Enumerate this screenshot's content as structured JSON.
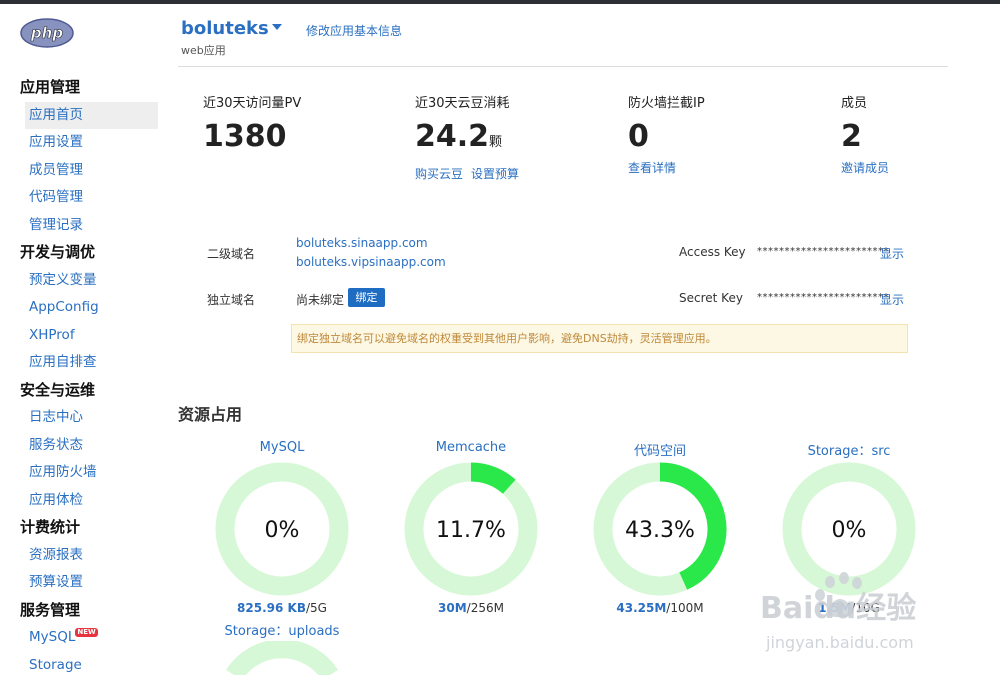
{
  "header": {
    "logo_text": "php",
    "app_name": "boluteks",
    "app_type": "web应用",
    "edit_link": "修改应用基本信息"
  },
  "sidebar": {
    "sections": [
      {
        "title": "应用管理",
        "items": [
          "应用首页",
          "应用设置",
          "成员管理",
          "代码管理",
          "管理记录"
        ]
      },
      {
        "title": "开发与调优",
        "items": [
          "预定义变量",
          "AppConfig",
          "XHProf",
          "应用自排查"
        ]
      },
      {
        "title": "安全与运维",
        "items": [
          "日志中心",
          "服务状态",
          "应用防火墙",
          "应用体检"
        ]
      },
      {
        "title": "计费统计",
        "items": [
          "资源报表",
          "预算设置"
        ]
      },
      {
        "title": "服务管理",
        "items": [
          "MySQL",
          "Storage"
        ]
      }
    ],
    "active_item": "应用首页",
    "new_badge": "NEW"
  },
  "stats": {
    "pv_label": "近30天访问量PV",
    "pv_value": "1380",
    "bean_label": "近30天云豆消耗",
    "bean_value": "24.2",
    "bean_unit": "颗",
    "buy_link": "购买云豆",
    "budget_link": "设置预算",
    "fw_label": "防火墙拦截IP",
    "fw_value": "0",
    "fw_link": "查看详情",
    "member_label": "成员",
    "member_value": "2",
    "invite_link": "邀请成员"
  },
  "domains": {
    "second_label": "二级域名",
    "second_1": "boluteks.sinaapp.com",
    "second_2": "boluteks.vipsinaapp.com",
    "custom_label": "独立域名",
    "unbound_text": "尚未绑定",
    "bind_button": "绑定",
    "access_key_label": "Access Key",
    "access_key_value": "************************",
    "secret_key_label": "Secret Key",
    "secret_key_value": "************************",
    "show_label": "显示",
    "notice": "绑定独立域名可以避免域名的权重受到其他用户影响，避免DNS劫持，灵活管理应用。"
  },
  "resources": {
    "title": "资源占用",
    "track_color": "#d6f8d6",
    "fill_color": "#2be84a",
    "gauges": [
      {
        "name": "MySQL",
        "percent_text": "0%",
        "fraction": 0.0,
        "used": "825.96 KB",
        "total": "/5G"
      },
      {
        "name": "Memcache",
        "percent_text": "11.7%",
        "fraction": 0.117,
        "used": "30M",
        "total": "/256M"
      },
      {
        "name": "代码空间",
        "percent_text": "43.3%",
        "fraction": 0.433,
        "used": "43.25M",
        "total": "/100M"
      },
      {
        "name": "Storage：src",
        "percent_text": "0%",
        "fraction": 0.0,
        "used": "1.5M",
        "total": "/10G"
      }
    ],
    "extra_gauge_name": "Storage：uploads"
  },
  "watermark": {
    "brand": "Baidu经验",
    "url": "jingyan.baidu.com"
  }
}
